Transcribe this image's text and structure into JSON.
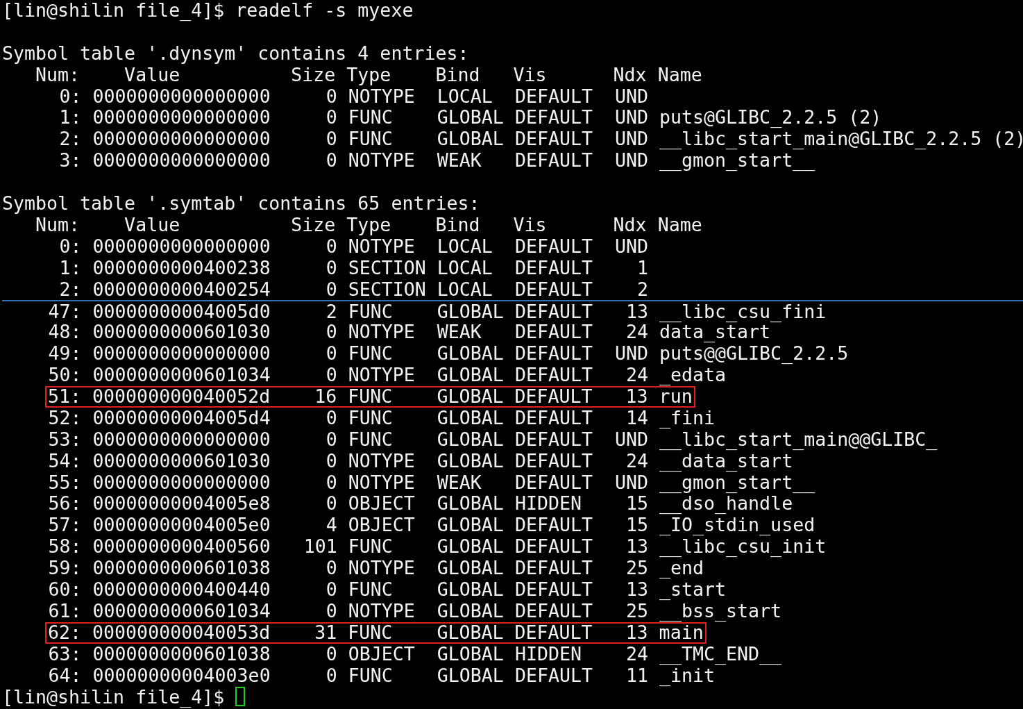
{
  "terminal": {
    "lines": [
      {
        "kind": "prompt",
        "text": "[lin@shilin file_4]$ readelf -s myexe"
      },
      {
        "kind": "blank"
      },
      {
        "kind": "heading",
        "text": "Symbol table '.dynsym' contains 4 entries:"
      },
      {
        "kind": "header",
        "text": "   Num:    Value          Size Type    Bind   Vis      Ndx Name"
      },
      {
        "kind": "row",
        "text": "     0: 0000000000000000     0 NOTYPE  LOCAL  DEFAULT  UND",
        "highlighted": false
      },
      {
        "kind": "row",
        "text": "     1: 0000000000000000     0 FUNC    GLOBAL DEFAULT  UND puts@GLIBC_2.2.5 (2)",
        "highlighted": false
      },
      {
        "kind": "row",
        "text": "     2: 0000000000000000     0 FUNC    GLOBAL DEFAULT  UND __libc_start_main@GLIBC_2.2.5 (2)",
        "highlighted": false
      },
      {
        "kind": "row",
        "text": "     3: 0000000000000000     0 NOTYPE  WEAK   DEFAULT  UND __gmon_start__",
        "highlighted": false
      },
      {
        "kind": "blank"
      },
      {
        "kind": "heading",
        "text": "Symbol table '.symtab' contains 65 entries:"
      },
      {
        "kind": "header",
        "text": "   Num:    Value          Size Type    Bind   Vis      Ndx Name"
      },
      {
        "kind": "row",
        "text": "     0: 0000000000000000     0 NOTYPE  LOCAL  DEFAULT  UND",
        "highlighted": false
      },
      {
        "kind": "row",
        "text": "     1: 0000000000400238     0 SECTION LOCAL  DEFAULT    1",
        "highlighted": false
      },
      {
        "kind": "row",
        "text": "     2: 0000000000400254     0 SECTION LOCAL  DEFAULT    2",
        "highlighted": false
      },
      {
        "kind": "spliced",
        "text": "    47: 00000000004005d0     2 FUNC    GLOBAL DEFAULT   13 __libc_csu_fini",
        "highlighted": false
      },
      {
        "kind": "row",
        "text": "    48: 0000000000601030     0 NOTYPE  WEAK   DEFAULT   24 data_start",
        "highlighted": false
      },
      {
        "kind": "row",
        "text": "    49: 0000000000000000     0 FUNC    GLOBAL DEFAULT  UND puts@@GLIBC_2.2.5",
        "highlighted": false
      },
      {
        "kind": "row",
        "text": "    50: 0000000000601034     0 NOTYPE  GLOBAL DEFAULT   24 _edata",
        "highlighted": false
      },
      {
        "kind": "row",
        "text": "    51: 000000000040052d    16 FUNC    GLOBAL DEFAULT   13 run",
        "highlighted": true
      },
      {
        "kind": "row",
        "text": "    52: 00000000004005d4     0 FUNC    GLOBAL DEFAULT   14 _fini",
        "highlighted": false
      },
      {
        "kind": "row",
        "text": "    53: 0000000000000000     0 FUNC    GLOBAL DEFAULT  UND __libc_start_main@@GLIBC_",
        "highlighted": false
      },
      {
        "kind": "row",
        "text": "    54: 0000000000601030     0 NOTYPE  GLOBAL DEFAULT   24 __data_start",
        "highlighted": false
      },
      {
        "kind": "row",
        "text": "    55: 0000000000000000     0 NOTYPE  WEAK   DEFAULT  UND __gmon_start__",
        "highlighted": false
      },
      {
        "kind": "row",
        "text": "    56: 00000000004005e8     0 OBJECT  GLOBAL HIDDEN    15 __dso_handle",
        "highlighted": false
      },
      {
        "kind": "row",
        "text": "    57: 00000000004005e0     4 OBJECT  GLOBAL DEFAULT   15 _IO_stdin_used",
        "highlighted": false
      },
      {
        "kind": "row",
        "text": "    58: 0000000000400560   101 FUNC    GLOBAL DEFAULT   13 __libc_csu_init",
        "highlighted": false
      },
      {
        "kind": "row",
        "text": "    59: 0000000000601038     0 NOTYPE  GLOBAL DEFAULT   25 _end",
        "highlighted": false
      },
      {
        "kind": "row",
        "text": "    60: 0000000000400440     0 FUNC    GLOBAL DEFAULT   13 _start",
        "highlighted": false
      },
      {
        "kind": "row",
        "text": "    61: 0000000000601034     0 NOTYPE  GLOBAL DEFAULT   25 __bss_start",
        "highlighted": false
      },
      {
        "kind": "row",
        "text": "    62: 000000000040053d    31 FUNC    GLOBAL DEFAULT   13 main",
        "highlighted": true
      },
      {
        "kind": "row",
        "text": "    63: 0000000000601038     0 OBJECT  GLOBAL HIDDEN    24 __TMC_END__",
        "highlighted": false
      },
      {
        "kind": "row",
        "text": "    64: 00000000004003e0     0 FUNC    GLOBAL DEFAULT   11 _init",
        "highlighted": false
      },
      {
        "kind": "prompt",
        "text": "[lin@shilin file_4]$",
        "cursor": true
      }
    ]
  }
}
